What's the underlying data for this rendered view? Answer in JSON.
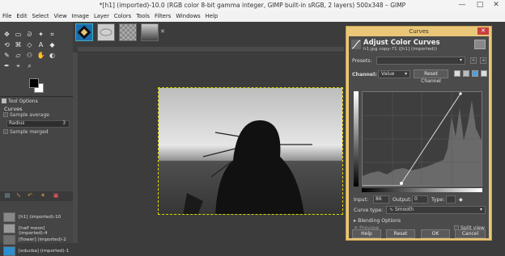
{
  "window": {
    "title": "*[h1] (imported)-10.0 (RGB color 8-bit gamma integer, GIMP built-in sRGB, 2 layers) 500x348 – GIMP",
    "minimize": "—",
    "maximize": "□",
    "close": "✕"
  },
  "menu": [
    "File",
    "Edit",
    "Select",
    "View",
    "Image",
    "Layer",
    "Colors",
    "Tools",
    "Filters",
    "Windows",
    "Help"
  ],
  "tool_options": {
    "tab_label": "Tool Options",
    "title": "Curves",
    "sample_average": "Sample average",
    "radius_label": "Radius",
    "radius_value": "3",
    "sample_merged": "Sample merged"
  },
  "layers": [
    {
      "label": "[h1] (imported)-10"
    },
    {
      "label": "[half moon] (imported)-4"
    },
    {
      "label": "[flower] (imported)-2"
    },
    {
      "label": "[educba] (imported)-1"
    }
  ],
  "curves": {
    "dialog_title": "Curves",
    "heading": "Adjust Color Curves",
    "subtitle": "h1.jpg copy-71 ([h1] (imported))",
    "presets_label": "Presets:",
    "channel_label": "Channel:",
    "channel_value": "Value",
    "reset_channel": "Reset Channel",
    "input_label": "Input:",
    "input_value": "86",
    "output_label": "Output:",
    "output_value": "0",
    "type_label": "Type:",
    "curve_type_label": "Curve type:",
    "curve_type_value": "Smooth",
    "blending_options": "Blending Options",
    "preview": "Preview",
    "split_view": "Split view",
    "buttons": {
      "help": "Help",
      "reset": "Reset",
      "ok": "OK",
      "cancel": "Cancel"
    }
  },
  "colors": {
    "accent": "#e9c678",
    "titlebar": "#f4f4f4",
    "canvas_bg": "#3c3c3c",
    "selection": "#d8d600"
  }
}
